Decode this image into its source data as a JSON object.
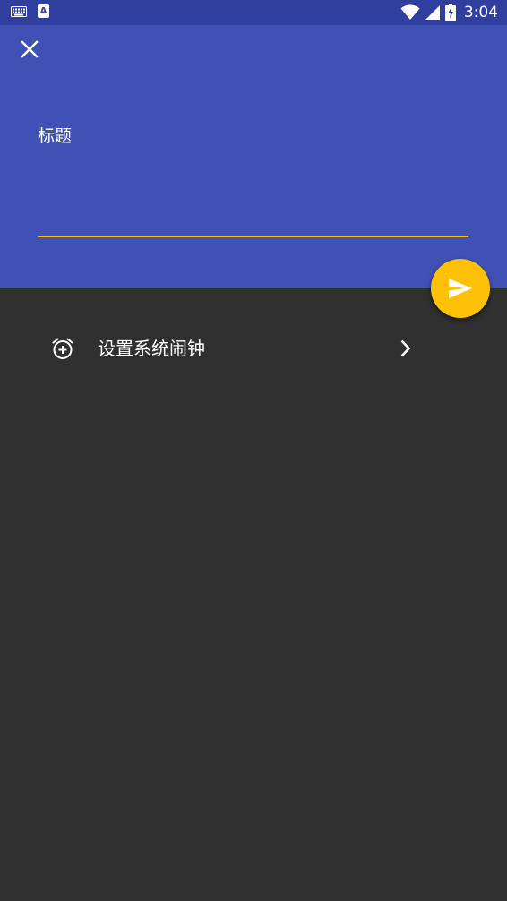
{
  "status_bar": {
    "time": "3:04",
    "left_icons": [
      "keyboard-icon",
      "a-app-icon"
    ],
    "right_icons": [
      "wifi-icon",
      "cell-signal-icon",
      "battery-charging-icon"
    ]
  },
  "header": {
    "close_icon": "close-icon",
    "title_placeholder": "标题",
    "title_value": ""
  },
  "fab": {
    "icon": "send-icon"
  },
  "alarm_row": {
    "icon": "alarm-add-icon",
    "label": "设置系统闹钟",
    "chevron_icon": "chevron-right-icon"
  },
  "colors": {
    "primary": "#3f51b5",
    "primary_dark": "#303f9f",
    "accent": "#ffc107",
    "background": "#303030"
  }
}
